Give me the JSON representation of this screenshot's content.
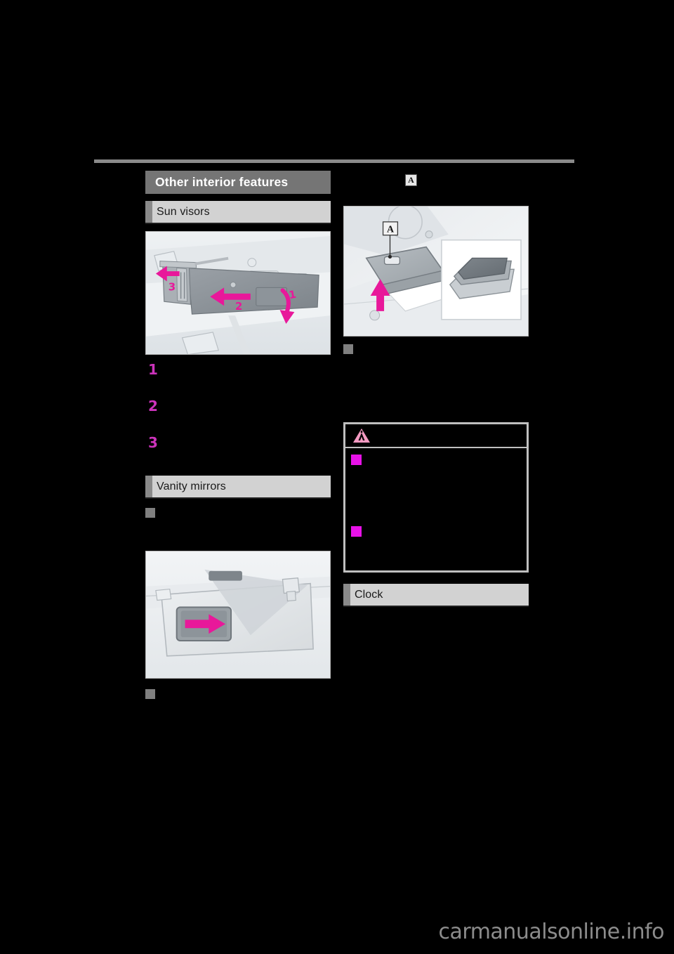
{
  "document": {
    "type": "vehicle-owners-manual-page",
    "background_color": "#000000",
    "rule_color": "#8a8a8a",
    "accent_magenta": "#e812e8",
    "step_number_color": "#cc33bb",
    "header_band_color": "#d2d2d2",
    "title_band_color": "#757575"
  },
  "left_column": {
    "section_title": "Other interior features",
    "sun_visors": {
      "header": "Sun visors",
      "figure": {
        "name": "sun-visor-illustration",
        "callouts": [
          "1",
          "2",
          "3"
        ],
        "description": "Sun visor shown at windshield header with three magenta direction arrows"
      },
      "steps": [
        {
          "number": "1",
          "text": ""
        },
        {
          "number": "2",
          "text": ""
        },
        {
          "number": "3",
          "text": ""
        }
      ]
    },
    "vanity_mirrors": {
      "header": "Vanity mirrors",
      "bullet_heading_top": "",
      "figure": {
        "name": "vanity-mirror-illustration",
        "description": "Sun visor flipped down with vanity mirror cover and a magenta slide arrow"
      },
      "bullet_heading_bottom": ""
    }
  },
  "right_column": {
    "callout_badge": "A",
    "figure": {
      "name": "console-tray-illustration",
      "callout_label": "A",
      "description": "Center console lid with inset detail view of removable tray and magenta lift arrow"
    },
    "subsection_heading": "",
    "body_text": "",
    "warning_box": {
      "icon": "warning-triangle-icon",
      "title": "",
      "items": [
        {
          "bullet": "square",
          "text": ""
        },
        {
          "bullet": "square",
          "text": ""
        }
      ]
    },
    "clock": {
      "header": "Clock",
      "body_text": ""
    }
  },
  "watermark": {
    "text": "carmanualsonline.info",
    "color": "#8c8c8c"
  }
}
